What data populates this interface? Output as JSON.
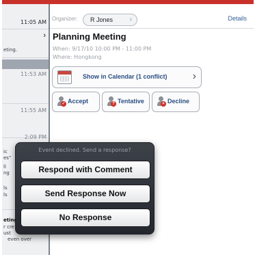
{
  "list": {
    "rows": [
      {
        "time": "11:05 AM",
        "snippet": "eting."
      },
      {
        "time": "11:53 AM"
      },
      {
        "time": "11:55 AM"
      },
      {
        "time": "2:09 PM",
        "snippets": [
          "ic",
          "es\"",
          "ll",
          "ng",
          "ls",
          "ls"
        ]
      },
      {
        "snippets": [
          "eting",
          "r cre",
          "ust",
          "even over"
        ]
      }
    ]
  },
  "organizer": {
    "label": "Organizer:",
    "name": "R Jones",
    "details_link": "Details"
  },
  "event": {
    "title": "Planning Meeting",
    "when": "When: 9/17/10 10:00 PM - 11:00 PM",
    "where": "Where: Hongkong",
    "calendar_label": "Show in Calendar (1 conflict)"
  },
  "responses": {
    "accept": "Accept",
    "tentative": "Tentative",
    "decline": "Decline"
  },
  "sheet": {
    "title": "Event declined. Send a response?",
    "buttons": [
      "Respond with Comment",
      "Send Response Now",
      "No Response"
    ]
  }
}
